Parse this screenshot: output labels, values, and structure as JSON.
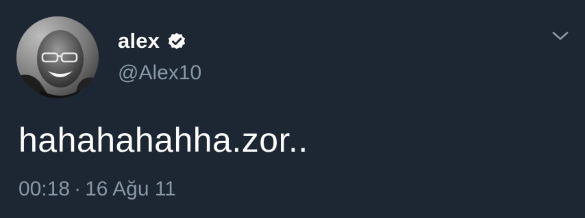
{
  "tweet": {
    "display_name": "alex",
    "handle": "@Alex10",
    "text": "hahahahahha.zor..",
    "time": "00:18",
    "separator": "·",
    "date": "16 Ağu 11",
    "verified_icon": "verified-badge-icon",
    "menu_icon": "chevron-down-icon",
    "avatar": "avatar"
  },
  "colors": {
    "background": "#1c2733",
    "primary_text": "#ffffff",
    "secondary_text": "#8899a6"
  }
}
